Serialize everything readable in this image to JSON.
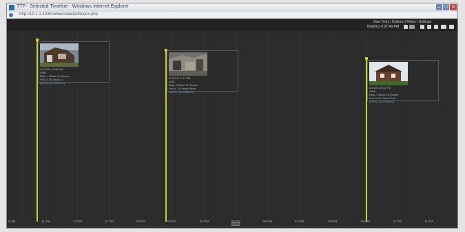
{
  "window": {
    "title": "TTP - Selected Timeline - Windows Internet Explorer",
    "url": "http://10.1.1.40/timeline/selected/index.php",
    "buttons": {
      "minimize": "–",
      "maximize": "□",
      "close": "✕"
    }
  },
  "toolbar": {
    "links": "View Tools | Options | Filters | Settings",
    "current_datetime": "6/3/2011  6:07:40 PM",
    "icons": [
      "zoom-in-icon",
      "zoom-out-icon",
      "rewind-icon",
      "play-icon",
      "forward-icon",
      "list-icon",
      "menu-icon"
    ]
  },
  "timeline": {
    "axis_labels": [
      "9 AM",
      "11 AM",
      "12 PM",
      "01 PM",
      "02 PM",
      "03 PM",
      "04 PM",
      "05 PM",
      "06 PM",
      "07 PM",
      "08 PM",
      "09 PM",
      "10 PM",
      "11 PM"
    ],
    "events": [
      {
        "time": "6/3/2011 10:06 AM",
        "id": "4960",
        "line1": "Bldg. 1 Block 24 Shown",
        "line2": "Pics & 16 Viewd 23",
        "link": "[More] | [Annotation]"
      },
      {
        "time": "6/3/2011 2:01 PM",
        "id": "4961",
        "line1": "Bldg. 3 Block 11 Shown",
        "line2": "Pics & 18 Viewd More",
        "link": "[More] | [Annotation]"
      },
      {
        "time": "6/3/2011 8:11 PM",
        "id": "4968",
        "line1": "Bldg. 2 Block 19 Shown",
        "line2": "Pics & 24 Viewd Post",
        "link": "[More] | [Annotation]"
      }
    ]
  },
  "colors": {
    "background": "#2c2c2c",
    "marker": "#c8cf24",
    "link": "#5f98cf"
  }
}
